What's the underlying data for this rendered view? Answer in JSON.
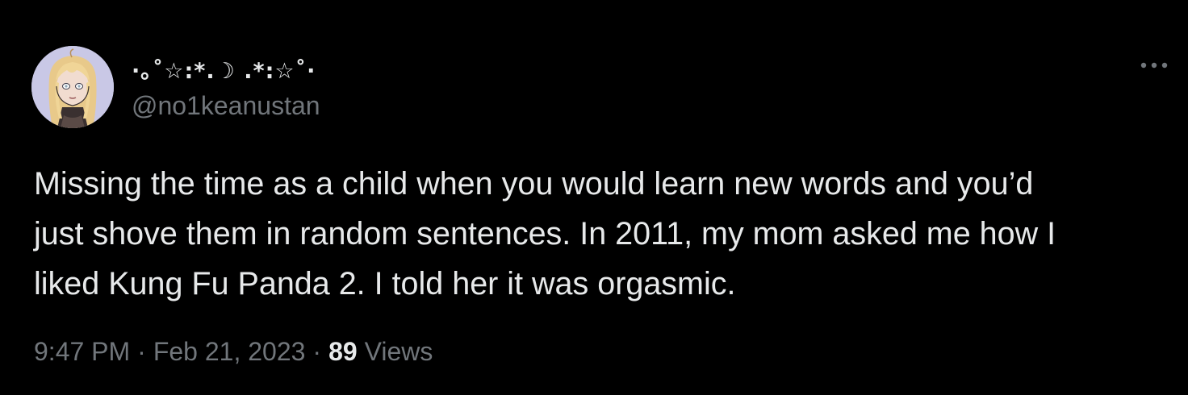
{
  "tweet": {
    "author": {
      "display_name": "·｡˚☆:*.☽ .*:☆˚·",
      "handle": "@no1keanustan",
      "avatar_icon": "illustrated-avatar-blonde-character"
    },
    "more_icon": "more-horizontal-icon",
    "text_lines": [
      "Missing the time as a child when you would learn new words and you’d",
      "just shove them in random sentences. In 2011, my mom asked me how I",
      "liked Kung Fu Panda 2. I told her it was orgasmic."
    ],
    "time": "9:47 PM",
    "date": "Feb 21, 2023",
    "separator": "·",
    "views_count": "89",
    "views_label": "Views"
  },
  "colors": {
    "background": "#000000",
    "primary_text": "#e7e9ea",
    "secondary_text": "#71767b"
  }
}
